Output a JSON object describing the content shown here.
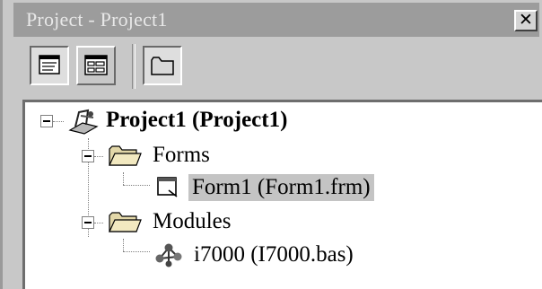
{
  "window": {
    "title": "Project - Project1",
    "close_glyph": "✕"
  },
  "toolbar": {
    "buttons": [
      {
        "name": "view-code-icon"
      },
      {
        "name": "view-object-icon"
      },
      {
        "name": "toggle-folders-icon"
      }
    ]
  },
  "tree": {
    "project": {
      "label": "Project1  (Project1)",
      "icon": "project-icon"
    },
    "forms_folder": {
      "label": "Forms",
      "icon": "folder-icon"
    },
    "form1": {
      "label": "Form1  (Form1.frm)",
      "icon": "form-icon"
    },
    "modules_folder": {
      "label": "Modules",
      "icon": "folder-icon"
    },
    "module1": {
      "label": "i7000 (I7000.bas)",
      "icon": "module-icon"
    }
  },
  "colors": {
    "titlebar": "#9c9c9c",
    "selection": "#c4c4c4",
    "chrome": "#c8c8c8"
  }
}
